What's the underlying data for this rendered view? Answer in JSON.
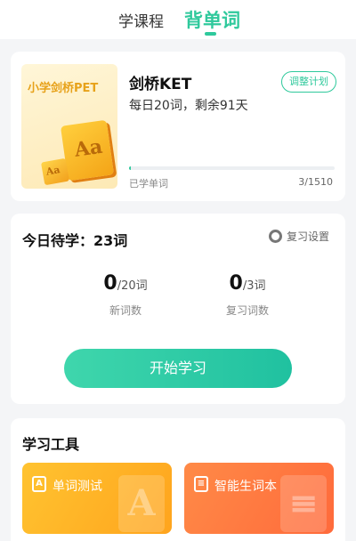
{
  "tabs": [
    {
      "label": "学课程",
      "active": false
    },
    {
      "label": "背单词",
      "active": true
    }
  ],
  "book": {
    "cover_title": "小学剑桥PET",
    "cover_glyph_big": "Aa",
    "cover_glyph_small": "Aa",
    "name": "剑桥KET",
    "plan": "每日20词，剩余91天",
    "adjust_label": "调整计划",
    "learned_label": "已学单词",
    "learned_count": "3/1510",
    "progress_fraction": 0.002
  },
  "today": {
    "title": "今日待学：23词",
    "settings_label": "复习设置",
    "settings_icon": "gear-icon",
    "new_words": {
      "value": "0",
      "suffix": "/20词",
      "label": "新词数"
    },
    "review_words": {
      "value": "0",
      "suffix": "/3词",
      "label": "复习词数"
    },
    "start_label": "开始学习"
  },
  "tools": {
    "title": "学习工具",
    "items": [
      {
        "label": "单词测试",
        "icon_glyph": "A",
        "deco_glyph": "A"
      },
      {
        "label": "智能生词本",
        "icon_glyph": "≡",
        "deco_glyph": "≡"
      }
    ]
  },
  "colors": {
    "accent": "#2fc99c",
    "quiz_card": "#ffb327",
    "vocab_card": "#ff7a41"
  }
}
